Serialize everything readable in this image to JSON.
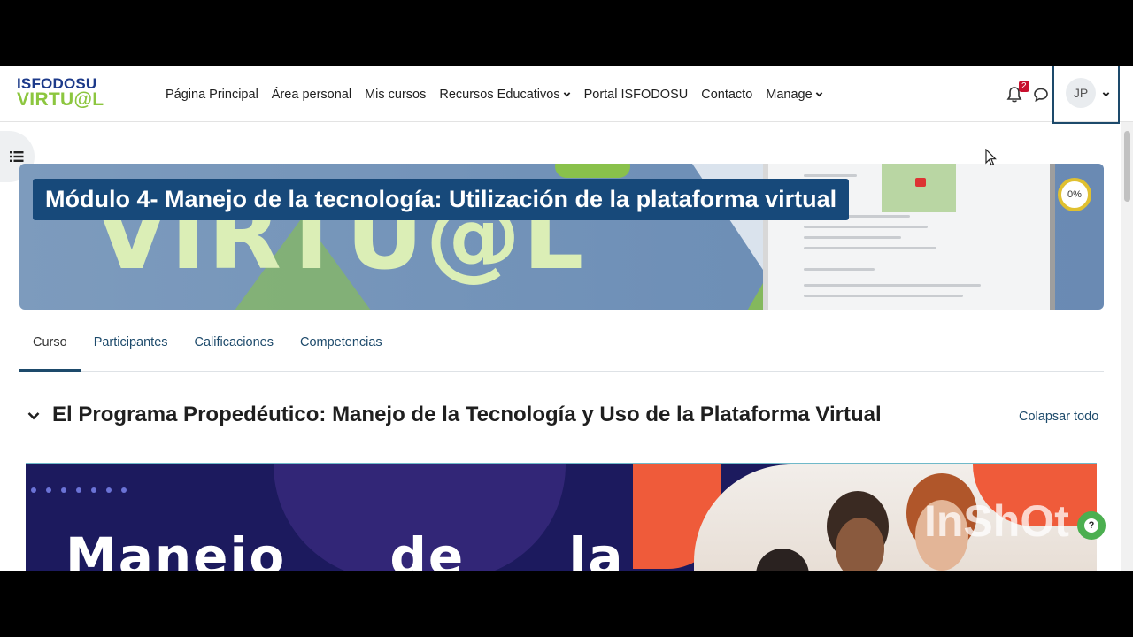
{
  "logo": {
    "top": "ISFODOSU",
    "bottom": "VIRTU@L"
  },
  "nav": {
    "items": [
      {
        "label": "Página Principal",
        "has_dropdown": false
      },
      {
        "label": "Área personal",
        "has_dropdown": false
      },
      {
        "label": "Mis cursos",
        "has_dropdown": false
      },
      {
        "label": "Recursos Educativos",
        "has_dropdown": true
      },
      {
        "label": "Portal ISFODOSU",
        "has_dropdown": false
      },
      {
        "label": "Contacto",
        "has_dropdown": false
      },
      {
        "label": "Manage",
        "has_dropdown": true
      }
    ],
    "notification_count": "2",
    "user_initials": "JP"
  },
  "banner": {
    "background_text": "VIRTU@L",
    "course_title": "Módulo 4- Manejo de la tecnología: Utilización de la plataforma virtual",
    "progress": "0%"
  },
  "tabs": [
    {
      "label": "Curso",
      "active": true
    },
    {
      "label": "Participantes",
      "active": false
    },
    {
      "label": "Calificaciones",
      "active": false
    },
    {
      "label": "Competencias",
      "active": false
    }
  ],
  "section": {
    "title": "El Programa Propedéutico: Manejo de la Tecnología y Uso de la Plataforma Virtual",
    "collapse_label": "Colapsar todo",
    "image_text": "Manejo de la",
    "watermark": "InShOt"
  },
  "help_label": "?",
  "colors": {
    "primary": "#1d4a6b",
    "title_bg": "#17497a",
    "brand_green": "#8cc63f",
    "badge_red": "#c8102e",
    "progress_ring": "#e0c030"
  }
}
